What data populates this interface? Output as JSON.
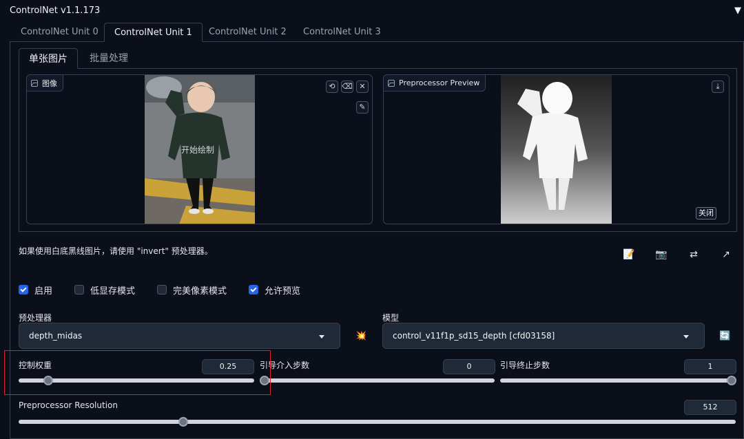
{
  "panel": {
    "title": "ControlNet v1.1.173",
    "collapse_glyph": "▼"
  },
  "unit_tabs": [
    {
      "label": "ControlNet Unit 0",
      "active": false
    },
    {
      "label": "ControlNet Unit 1",
      "active": true
    },
    {
      "label": "ControlNet Unit 2",
      "active": false
    },
    {
      "label": "ControlNet Unit 3",
      "active": false
    }
  ],
  "image_tabs": [
    {
      "label": "单张图片",
      "active": true
    },
    {
      "label": "批量处理",
      "active": false
    }
  ],
  "image_input": {
    "label": "图像",
    "overlay_text": "开始绘制",
    "buttons": [
      {
        "name": "undo-icon",
        "glyph": "⟲"
      },
      {
        "name": "eraser-icon",
        "glyph": "⌫"
      },
      {
        "name": "close-icon",
        "glyph": "✕"
      },
      {
        "name": "brush-icon",
        "glyph": "✎"
      }
    ]
  },
  "preview": {
    "label": "Preprocessor Preview",
    "download_glyph": "⤓",
    "close_label": "关闭"
  },
  "hint": "如果使用白底黑线图片，请使用 \"invert\" 预处理器。",
  "tools": [
    {
      "name": "notepad-icon",
      "glyph": "📝"
    },
    {
      "name": "camera-icon",
      "glyph": "📷"
    },
    {
      "name": "swap-icon",
      "glyph": "⇄"
    },
    {
      "name": "send-arrow-icon",
      "glyph": "↗"
    }
  ],
  "checkboxes": [
    {
      "label": "启用",
      "checked": true
    },
    {
      "label": "低显存模式",
      "checked": false
    },
    {
      "label": "完美像素模式",
      "checked": false
    },
    {
      "label": "允许预览",
      "checked": true
    }
  ],
  "preprocessor": {
    "label": "预处理器",
    "value": "depth_midas",
    "run_icon": "💥"
  },
  "model": {
    "label": "模型",
    "value": "control_v11f1p_sd15_depth [cfd03158]",
    "refresh_icon": "🔄"
  },
  "sliders": {
    "weight": {
      "label": "控制权重",
      "value": "0.25",
      "fraction": 0.125
    },
    "start": {
      "label": "引导介入步数",
      "value": "0",
      "fraction": 0.0
    },
    "end": {
      "label": "引导终止步数",
      "value": "1",
      "fraction": 1.0
    },
    "resolution": {
      "label": "Preprocessor Resolution",
      "value": "512",
      "fraction": 0.23
    }
  },
  "colors": {
    "accent": "#2563eb",
    "highlight": "#e11d2e",
    "background": "#0b0f19"
  }
}
